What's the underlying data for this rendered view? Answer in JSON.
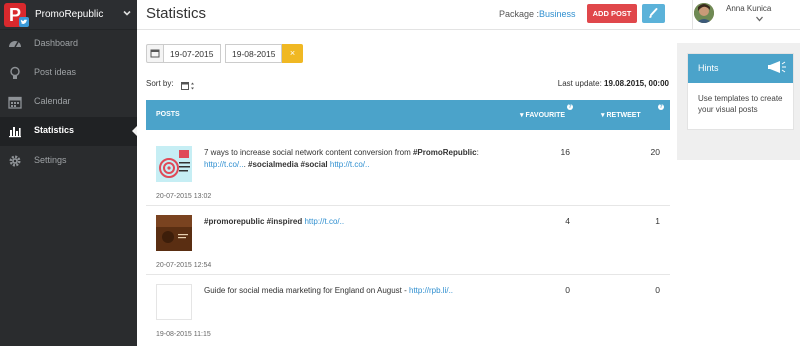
{
  "app": {
    "brand_name": "PromoRepublic",
    "logo_letter": "P"
  },
  "sidebar": {
    "items": [
      {
        "label": "Dashboard",
        "icon": "dashboard-icon",
        "active": false
      },
      {
        "label": "Post ideas",
        "icon": "lightbulb-icon",
        "active": false
      },
      {
        "label": "Calendar",
        "icon": "calendar-icon",
        "active": false
      },
      {
        "label": "Statistics",
        "icon": "bar-chart-icon",
        "active": true
      },
      {
        "label": "Settings",
        "icon": "gear-icon",
        "active": false
      }
    ]
  },
  "header": {
    "title": "Statistics",
    "package_label": "Package :",
    "package_value": "Business",
    "add_post_label": "ADD POST",
    "user_name": "Anna Kunica"
  },
  "filters": {
    "date_from": "19-07-2015",
    "date_to": "19-08-2015",
    "clear_symbol": "×",
    "sort_label": "Sort by:",
    "last_update_label": "Last update:",
    "last_update_value": "19.08.2015, 00:00"
  },
  "table": {
    "columns": {
      "posts": "POSTS",
      "favourite": "FAVOURITE",
      "retweet": "RETWEET"
    },
    "rows": [
      {
        "text_plain_1": "7 ways to increase social network content conversion from ",
        "text_bold_1": "#PromoRepublic",
        "text_plain_2": ": ",
        "link_1": "http://t.co/..",
        "text_plain_3": ". ",
        "text_bold_2": "#socialmedia #social",
        "text_plain_4": " ",
        "link_2": "http://t.co/..",
        "favourite": "16",
        "retweet": "20",
        "timestamp": "20-07-2015 13:02"
      },
      {
        "text_bold_1": "#promorepublic #inspired",
        "text_plain_1": " ",
        "link_1": "http://t.co/..",
        "favourite": "4",
        "retweet": "1",
        "timestamp": "20-07-2015 12:54"
      },
      {
        "text_plain_1": "Guide for social media marketing for England on August - ",
        "link_1": "http://rpb.li/..",
        "favourite": "0",
        "retweet": "0",
        "timestamp": "19-08-2015 11:15"
      }
    ]
  },
  "hints": {
    "title": "Hints",
    "body": "Use templates to create your visual posts"
  },
  "colors": {
    "sidebar_bg": "#2a2c2e",
    "accent_blue": "#4ba3ca",
    "add_post_red": "#e0474b",
    "clear_yellow": "#f0b823",
    "link_blue": "#2f8fd0"
  }
}
